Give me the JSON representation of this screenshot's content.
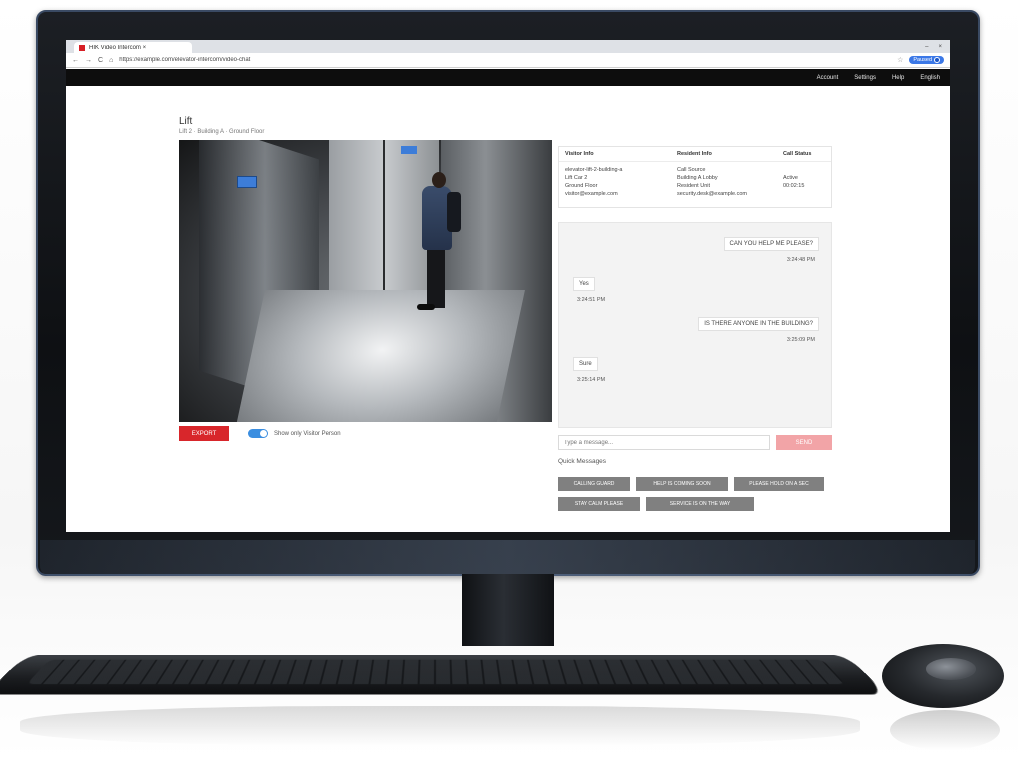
{
  "browser": {
    "tab_title": "HIK Video Intercom ×",
    "tab_close": "×",
    "window_controls": [
      "–",
      "×"
    ],
    "nav": {
      "back": "←",
      "forward": "→",
      "reload": "C",
      "home": "⌂"
    },
    "url": "https://example.com/elevator-intercom/video-chat",
    "star": "☆",
    "profile_label": "Paused"
  },
  "topnav": {
    "items": [
      "Account",
      "Settings",
      "Help",
      "English"
    ]
  },
  "page": {
    "title": "Lift",
    "subtitle": "Lift 2 · Building A · Ground Floor"
  },
  "video": {
    "export_label": "EXPORT",
    "toggle_label": "Show only Visitor Person",
    "toggle_on": true
  },
  "info": {
    "headers": [
      "Visitor Info",
      "Resident Info",
      "Call Status"
    ],
    "col1": [
      "elevator-lift-2-building-a",
      "Lift Car 2",
      "Ground Floor",
      "visitor@example.com"
    ],
    "col2": [
      "Call Source",
      "Building A Lobby",
      "Resident Unit",
      "security.desk@example.com"
    ],
    "col3": [
      "",
      "Active",
      "00:02:15"
    ]
  },
  "chat": {
    "messages": [
      {
        "text": "CAN YOU HELP ME PLEASE?",
        "time": "3:24:48 PM",
        "side": "right"
      },
      {
        "text": "Yes",
        "time": "3:24:51 PM",
        "side": "left"
      },
      {
        "text": "IS THERE ANYONE IN THE BUILDING?",
        "time": "3:25:09 PM",
        "side": "right"
      },
      {
        "text": "Sure",
        "time": "3:25:14 PM",
        "side": "left"
      }
    ],
    "input_placeholder": "Type a message...",
    "send_label": "SEND"
  },
  "quick": {
    "label": "Quick Messages",
    "buttons": [
      "CALLING GUARD",
      "HELP IS COMING SOON",
      "PLEASE HOLD ON A SEC",
      "STAY CALM PLEASE",
      "SERVICE IS ON THE WAY"
    ]
  },
  "colors": {
    "accent_red": "#d8262b",
    "send_pink": "#f2a4a7",
    "toggle_blue": "#3b8ee0",
    "quick_gray": "#808080",
    "topnav_black": "#0d0d0d"
  }
}
